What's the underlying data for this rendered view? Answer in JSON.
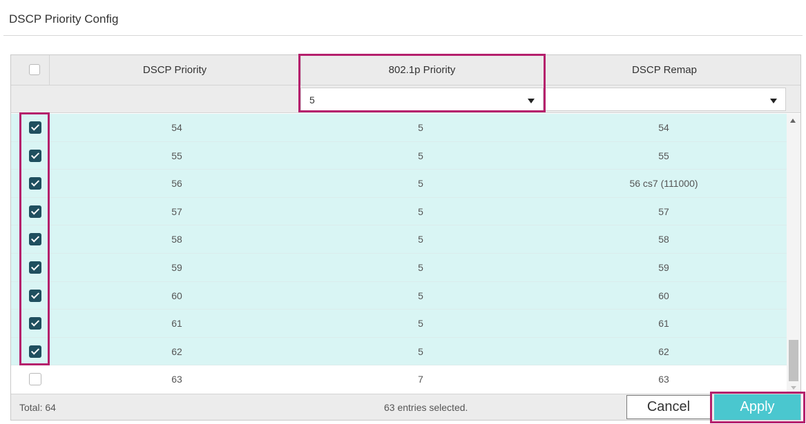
{
  "panel": {
    "title": "DSCP Priority Config"
  },
  "table": {
    "columns": [
      "DSCP Priority",
      "802.1p Priority",
      "DSCP Remap"
    ],
    "filter": {
      "priority_value": "5",
      "remap_value": ""
    },
    "rows": [
      {
        "dscp": "54",
        "priority": "5",
        "remap": "54",
        "checked": true
      },
      {
        "dscp": "55",
        "priority": "5",
        "remap": "55",
        "checked": true
      },
      {
        "dscp": "56",
        "priority": "5",
        "remap": "56 cs7 (111000)",
        "checked": true
      },
      {
        "dscp": "57",
        "priority": "5",
        "remap": "57",
        "checked": true
      },
      {
        "dscp": "58",
        "priority": "5",
        "remap": "58",
        "checked": true
      },
      {
        "dscp": "59",
        "priority": "5",
        "remap": "59",
        "checked": true
      },
      {
        "dscp": "60",
        "priority": "5",
        "remap": "60",
        "checked": true
      },
      {
        "dscp": "61",
        "priority": "5",
        "remap": "61",
        "checked": true
      },
      {
        "dscp": "62",
        "priority": "5",
        "remap": "62",
        "checked": true
      },
      {
        "dscp": "63",
        "priority": "7",
        "remap": "63",
        "checked": false
      }
    ]
  },
  "footer": {
    "total": "Total: 64",
    "selected": "63 entries selected.",
    "cancel_label": "Cancel",
    "apply_label": "Apply"
  },
  "colors": {
    "selected_row": "#d9f5f4",
    "checkbox": "#1f4f5f",
    "apply": "#4ac7cf",
    "highlight": "#b5206c"
  }
}
